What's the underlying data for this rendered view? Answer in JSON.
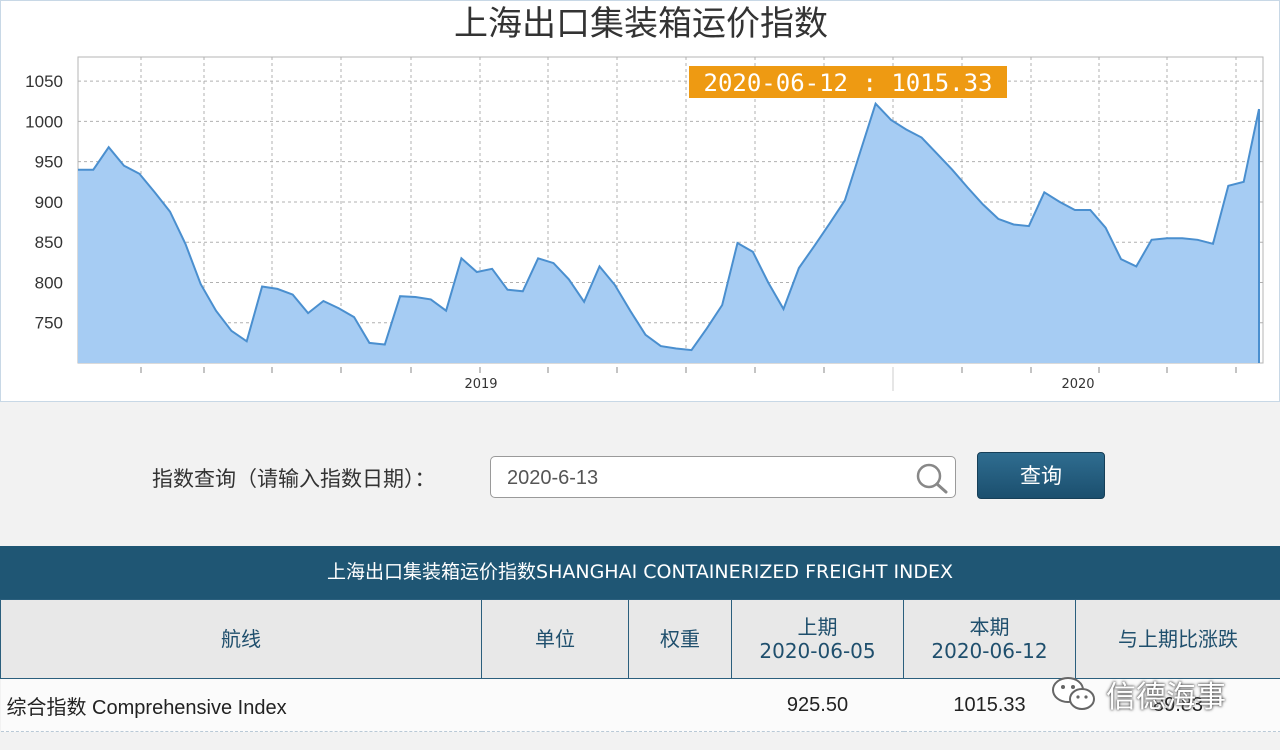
{
  "chart_data": {
    "type": "area",
    "title": "上海出口集装箱运价指数",
    "tooltip": "2020-06-12 : 1015.33",
    "y_ticks": [
      "1050",
      "1000",
      "950",
      "900",
      "850",
      "800",
      "750"
    ],
    "x_tick_labels": [
      "2019",
      "2020"
    ],
    "ylim": [
      700,
      1080
    ],
    "grid": true,
    "series": [
      {
        "values": [
          940,
          940,
          968,
          945,
          935,
          912,
          888,
          848,
          798,
          765,
          740,
          727,
          795,
          792,
          785,
          762,
          777,
          768,
          757,
          725,
          723,
          783,
          782,
          779,
          765,
          830,
          813,
          817,
          791,
          789,
          830,
          824,
          804,
          776,
          820,
          797,
          765,
          735,
          721,
          718,
          716,
          743,
          772,
          849,
          838,
          800,
          767,
          818,
          845,
          873,
          902,
          962,
          1022,
          1002,
          990,
          980,
          960,
          940,
          918,
          897,
          879,
          872,
          870,
          912,
          900,
          890,
          890,
          868,
          829,
          820,
          853,
          855,
          855,
          853,
          848,
          920,
          925,
          1015.33
        ]
      }
    ]
  },
  "query": {
    "label": "指数查询（请输入指数日期）：",
    "input_value": "2020-6-13",
    "button_label": "查询"
  },
  "table": {
    "title": "上海出口集装箱运价指数SHANGHAI CONTAINERIZED FREIGHT INDEX",
    "headers": {
      "route": "航线",
      "unit": "单位",
      "weight": "权重",
      "prev_label": "上期",
      "prev_date": "2020-06-05",
      "curr_label": "本期",
      "curr_date": "2020-06-12",
      "change": "与上期比涨跌"
    },
    "row": {
      "route": "综合指数 Comprehensive Index",
      "unit": "",
      "weight": "",
      "prev": "925.50",
      "curr": "1015.33",
      "change": "89.83"
    }
  },
  "watermark": {
    "text": "信德海事"
  },
  "colors": {
    "area_fill": "#a6ccf3",
    "line": "#4a8fcf",
    "tooltip_bg": "#ee9a12",
    "header_bg": "#1f5674",
    "button_bg": "#1b4f6e"
  }
}
